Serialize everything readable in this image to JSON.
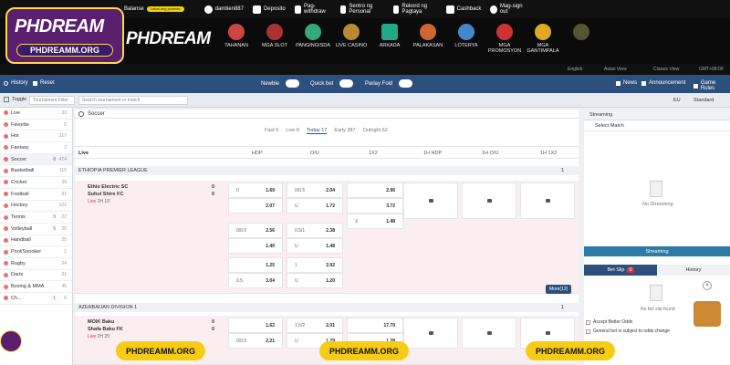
{
  "top": {
    "balance_label": "Balanse",
    "currency_pill": "Lahat ang\npuwede",
    "user": "damtien887",
    "deposit": "Deposito",
    "withdraw": "Pag-withdraw",
    "personal": "Sentro ng Personal",
    "record": "Rekord ng Pagtaya",
    "cashback": "Cashback",
    "signout": "Mag-sign out"
  },
  "brand": {
    "logo": "PHDREAM",
    "site": "PHDREAMM.ORG"
  },
  "nav": [
    "TAHANAN",
    "MGA SLOT",
    "PANGINGISDA",
    "LIVE CASINO",
    "ARKADA",
    "PALAKASAN",
    "LOTERYA",
    "MGA PROMOSYON",
    "MGA GANTIMPALA"
  ],
  "sub": {
    "lang": "English",
    "view": "Asian View",
    "classic": "Classic View",
    "tz": "GMT+08:00"
  },
  "bar": {
    "history": "History",
    "reset": "Reset",
    "newbie": "Newbie",
    "quickbet": "Quick bet",
    "parlay": "Parlay Fold",
    "news": "News",
    "announcement": "Announcement",
    "rules": "Game Rules"
  },
  "bar2": {
    "toggle": "Toggle",
    "filter_placeholder": "Tournament Filter",
    "search_placeholder": "Search tournament or match",
    "eu": "EU",
    "standard": "Standard"
  },
  "sidebar": [
    {
      "label": "Live",
      "count": "33"
    },
    {
      "label": "Favorite",
      "count": "0"
    },
    {
      "label": "Hot",
      "count": "317"
    },
    {
      "label": "Fantasy",
      "count": "2"
    },
    {
      "label": "Soccer",
      "live": "8",
      "count": "474"
    },
    {
      "label": "Basketball",
      "count": "115"
    },
    {
      "label": "Cricket",
      "count": "39"
    },
    {
      "label": "Football",
      "count": "31"
    },
    {
      "label": "Hockey",
      "count": "122"
    },
    {
      "label": "Tennis",
      "live": "9",
      "count": "22"
    },
    {
      "label": "Volleyball",
      "live": "5",
      "count": "25"
    },
    {
      "label": "Handball",
      "count": "25"
    },
    {
      "label": "Pool/Snooker",
      "count": "1"
    },
    {
      "label": "Rugby",
      "count": "24"
    },
    {
      "label": "Darts",
      "count": "31"
    },
    {
      "label": "Boxing & MMA",
      "count": "45"
    },
    {
      "label": "Ch...",
      "live": "1",
      "count": "6"
    }
  ],
  "main": {
    "title": "Soccer",
    "tabs": [
      "Fast 0",
      "Live 8",
      "Today 17",
      "Early 387",
      "Outright 62"
    ],
    "cols": [
      "Live",
      "HDP",
      "O/U",
      "1X2",
      "1H HDP",
      "1H O/U",
      "1H 1X2"
    ],
    "league1": "ETHIOPIA PREMIER LEAGUE",
    "league1_count": "1",
    "m1": {
      "home": "Ethio Electric SC",
      "away": "Suhul Shire FC",
      "live": "Live",
      "time": "2H 19'",
      "hs": "0",
      "as": "0"
    },
    "m1rows": [
      {
        "h1": "0",
        "o1": "1.69",
        "h2": "0/0.5",
        "o2": "2.04",
        "x1": "",
        "o3": "2.96"
      },
      {
        "h1": "",
        "o1": "2.07",
        "h2": "U",
        "o2": "1.72",
        "x1": "",
        "o3": "3.72"
      },
      {
        "h1": "",
        "o1": "",
        "h2": "",
        "o2": "",
        "x1": "X",
        "o3": "1.48"
      }
    ],
    "m1alt": [
      {
        "h1": "0/0.5",
        "o1": "2.56",
        "h2": "0.5/1",
        "o2": "2.38"
      },
      {
        "h1": "",
        "o1": "1.40",
        "h2": "U",
        "o2": "1.48"
      },
      {
        "h1": "",
        "o1": "1.25",
        "h2": "1",
        "o2": "2.92"
      },
      {
        "h1": "0.5",
        "o1": "3.04",
        "h2": "U",
        "o2": "1.20"
      }
    ],
    "more": "More(12)",
    "league2": "AZERBAIJAN DIVISION 1",
    "league2_count": "1",
    "m2": {
      "home": "MOIK Baku",
      "away": "Shafa Baku FK",
      "live": "Live",
      "time": "2H 25'",
      "hs": "0",
      "as": "0"
    },
    "m2rows": [
      {
        "h1": "",
        "o1": "1.62",
        "h2": "1.5/2",
        "o2": "2.01",
        "o3": "17.70"
      },
      {
        "h1": "0/0.5",
        "o1": "2.21",
        "h2": "U",
        "o2": "1.79",
        "o3": "1.28"
      }
    ]
  },
  "right": {
    "streaming": "Streaming",
    "select": "Select Match",
    "nostream": "No Streaming",
    "streambtn": "Streaming",
    "betslip": "Bet Slip",
    "betcount": "0",
    "history": "History",
    "nobet": "No bet slip found",
    "accept": "Accept Better Odds",
    "general": "General bet is subject to odds change"
  },
  "promo": [
    "PHDREAMM.ORG",
    "PHDREAMM.ORG",
    "PHDREAMM.ORG"
  ],
  "colors": {
    "navy": "#2d4f7c",
    "promo": "#f6cd14",
    "live": "#d33"
  }
}
